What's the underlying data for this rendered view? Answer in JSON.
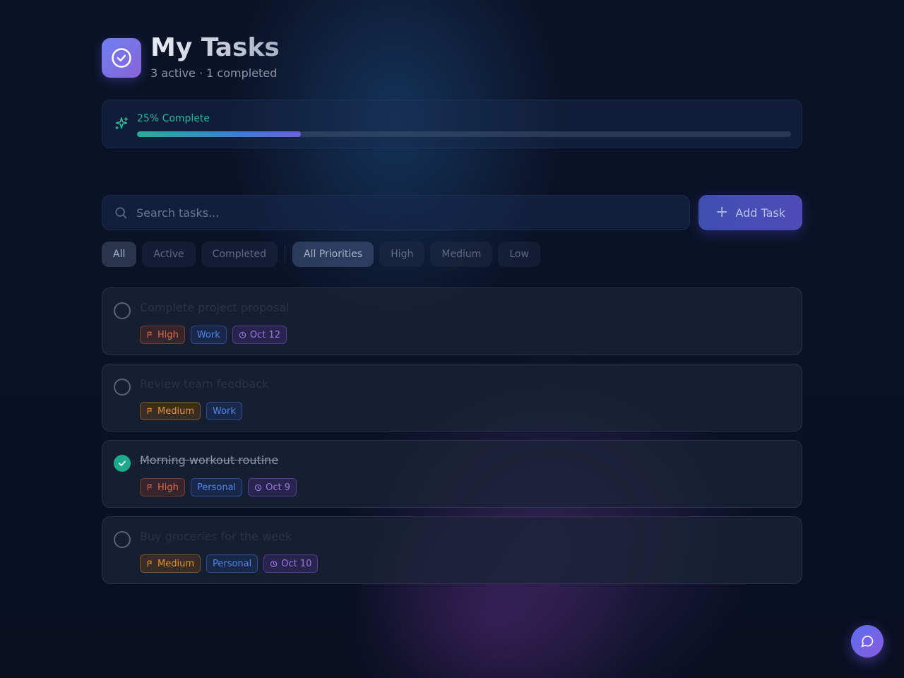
{
  "header": {
    "title": "My Tasks",
    "subtitle": "3 active · 1 completed",
    "logo_icon": "check-circle-icon"
  },
  "progress": {
    "label": "25% Complete",
    "percent": 25,
    "icon": "sparkles-icon"
  },
  "search": {
    "placeholder": "Search tasks...",
    "value": ""
  },
  "add_button": {
    "label": "Add Task"
  },
  "status_filters": [
    {
      "label": "All",
      "active": true
    },
    {
      "label": "Active",
      "active": false
    },
    {
      "label": "Completed",
      "active": false
    }
  ],
  "priority_filters": [
    {
      "label": "All Priorities",
      "active": true
    },
    {
      "label": "High",
      "active": false
    },
    {
      "label": "Medium",
      "active": false
    },
    {
      "label": "Low",
      "active": false
    }
  ],
  "tasks": [
    {
      "title": "Complete project proposal",
      "completed": false,
      "priority": "High",
      "category": "Work",
      "due": "Oct 12"
    },
    {
      "title": "Review team feedback",
      "completed": false,
      "priority": "Medium",
      "category": "Work",
      "due": ""
    },
    {
      "title": "Morning workout routine",
      "completed": true,
      "priority": "High",
      "category": "Personal",
      "due": "Oct 9"
    },
    {
      "title": "Buy groceries for the week",
      "completed": false,
      "priority": "Medium",
      "category": "Personal",
      "due": "Oct 10"
    }
  ],
  "colors": {
    "accent": "#6e7ff0",
    "success": "#1fa98c",
    "high": "#e06a48",
    "medium": "#e4912e",
    "category": "#4f88e6",
    "date": "#9a78e6"
  },
  "chat_button": {
    "icon": "chat-bubble-icon"
  }
}
